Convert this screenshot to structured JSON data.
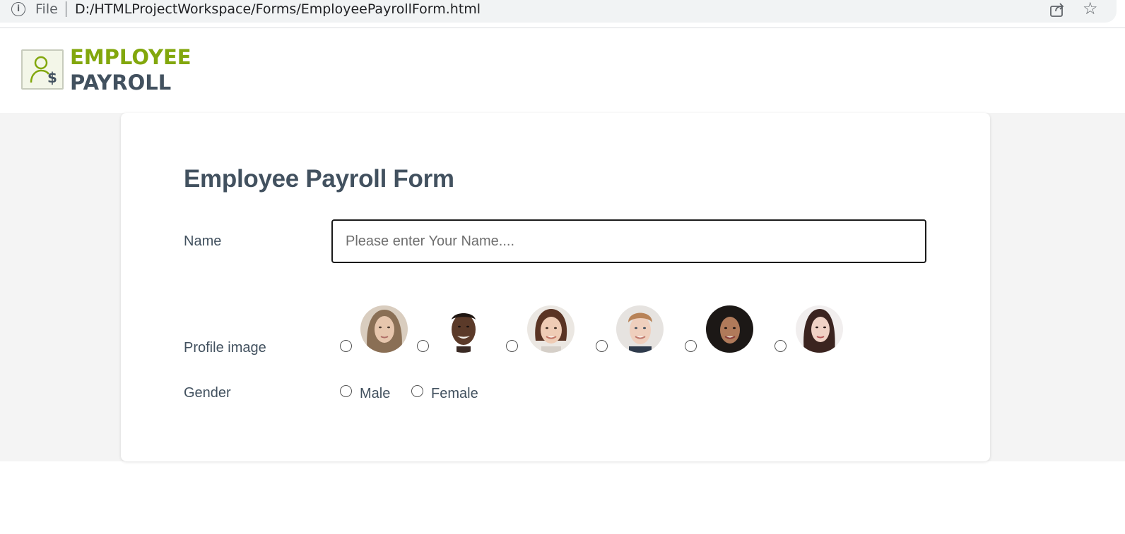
{
  "browser": {
    "info_icon": "info-icon",
    "scheme_label": "File",
    "url": "D:/HTMLProjectWorkspace/Forms/EmployeePayrollForm.html",
    "share_icon": "share-icon",
    "star_icon": "star-icon"
  },
  "header": {
    "logo_icon": "employee-dollar-icon",
    "logo_line1": "EMPLOYEE",
    "logo_line2": "PAYROLL",
    "colors": {
      "green": "#82a70c",
      "slate": "#42515f"
    }
  },
  "form": {
    "title": "Employee Payroll Form",
    "name_label": "Name",
    "name_placeholder": "Please enter Your Name....",
    "name_value": "",
    "profile_label": "Profile image",
    "profile_images": [
      {
        "icon": "woman-light-hair-avatar",
        "selected": false
      },
      {
        "icon": "man-dark-skin-avatar",
        "selected": false
      },
      {
        "icon": "woman-brown-hair-avatar",
        "selected": false
      },
      {
        "icon": "man-blond-avatar",
        "selected": false
      },
      {
        "icon": "woman-dark-hair-avatar",
        "selected": false
      },
      {
        "icon": "woman-asian-avatar",
        "selected": false
      }
    ],
    "gender_label": "Gender",
    "gender_options": [
      "Male",
      "Female"
    ]
  }
}
